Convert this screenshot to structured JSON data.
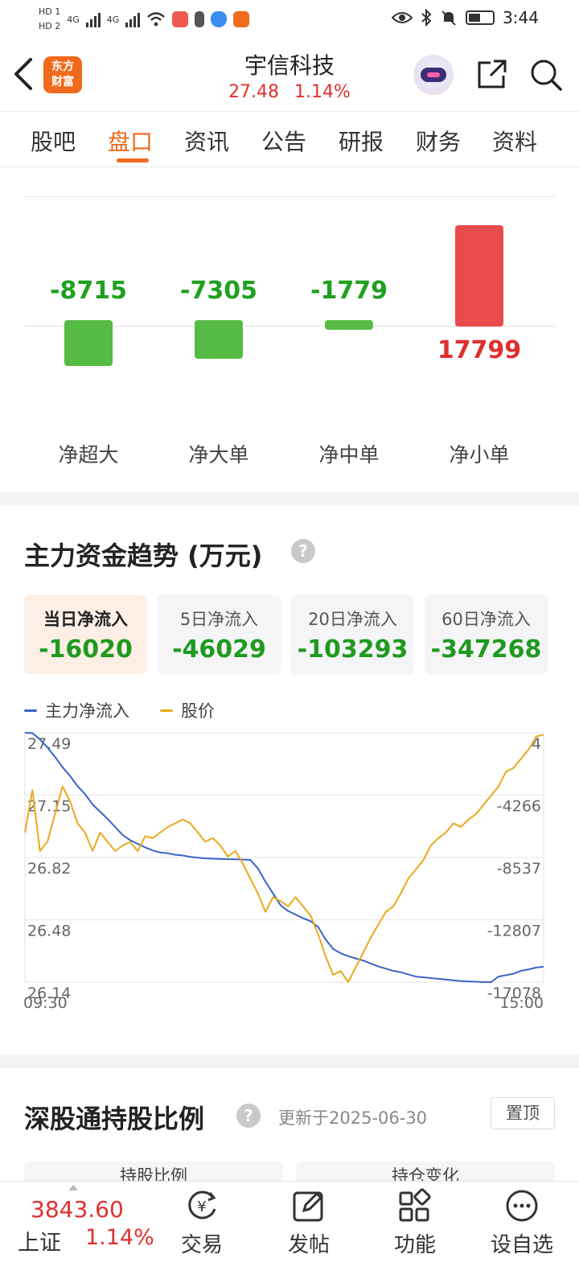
{
  "status_bar": {
    "time": "3:44",
    "sim1": "HD 1",
    "sim2": "HD 2",
    "net1": "4G",
    "net2": "4G"
  },
  "header": {
    "logo_line1": "东方",
    "logo_line2": "财富",
    "stock_name": "宇信科技",
    "price": "27.48",
    "change_pct": "1.14%"
  },
  "tabs": [
    "股吧",
    "盘口",
    "资讯",
    "公告",
    "研报",
    "财务",
    "资料"
  ],
  "active_tab": "盘口",
  "net_flow": {
    "items": [
      {
        "label": "净超大",
        "value": "-8715"
      },
      {
        "label": "净大单",
        "value": "-7305"
      },
      {
        "label": "净中单",
        "value": "-1779"
      },
      {
        "label": "净小单",
        "value": "17799"
      }
    ]
  },
  "trend": {
    "title": "主力资金趋势 (万元)",
    "periods": [
      {
        "label": "当日净流入",
        "value": "-16020"
      },
      {
        "label": "5日净流入",
        "value": "-46029"
      },
      {
        "label": "20日净流入",
        "value": "-103293"
      },
      {
        "label": "60日净流入",
        "value": "-347268"
      }
    ],
    "legend_main": "主力净流入",
    "legend_price": "股价"
  },
  "chart_data": {
    "type": "line",
    "x_start": "09:30",
    "x_end": "15:00",
    "left_axis_ticks": [
      "27.49",
      "27.15",
      "26.82",
      "26.48",
      "26.14"
    ],
    "right_axis_ticks": [
      "4",
      "-4266",
      "-8537",
      "-12807",
      "-17078"
    ],
    "series": [
      {
        "name": "主力净流入",
        "color": "#3a63c8",
        "axis": "right",
        "values": [
          4,
          -20,
          -450,
          -1000,
          -1650,
          -2350,
          -2950,
          -3650,
          -4200,
          -4900,
          -5400,
          -5900,
          -6450,
          -7000,
          -7350,
          -7600,
          -7850,
          -8050,
          -8200,
          -8250,
          -8350,
          -8400,
          -8500,
          -8550,
          -8600,
          -8620,
          -8640,
          -8650,
          -8660,
          -8680,
          -8700,
          -9300,
          -10200,
          -11000,
          -11800,
          -12200,
          -12450,
          -12700,
          -12900,
          -13300,
          -14150,
          -14800,
          -15100,
          -15300,
          -15450,
          -15600,
          -15800,
          -16000,
          -16150,
          -16300,
          -16400,
          -16550,
          -16700,
          -16750,
          -16800,
          -16850,
          -16900,
          -16950,
          -17000,
          -17030,
          -17050,
          -17070,
          -17078,
          -16700,
          -16600,
          -16500,
          -16300,
          -16200,
          -16080,
          -16020
        ]
      },
      {
        "name": "股价",
        "color": "#eaa91c",
        "axis": "left",
        "values": [
          26.95,
          27.18,
          26.85,
          26.9,
          27.05,
          27.2,
          27.12,
          27.0,
          26.95,
          26.85,
          26.95,
          26.9,
          26.85,
          26.88,
          26.9,
          26.85,
          26.93,
          26.92,
          26.95,
          26.98,
          27.0,
          27.02,
          27.0,
          26.95,
          26.9,
          26.92,
          26.88,
          26.82,
          26.85,
          26.78,
          26.7,
          26.62,
          26.52,
          26.6,
          26.58,
          26.55,
          26.6,
          26.55,
          26.5,
          26.4,
          26.28,
          26.18,
          26.2,
          26.12,
          26.22,
          26.3,
          26.38,
          26.45,
          26.52,
          26.55,
          26.62,
          26.7,
          26.75,
          26.8,
          26.88,
          26.92,
          26.95,
          27.0,
          26.98,
          27.02,
          27.05,
          27.1,
          27.15,
          27.2,
          27.28,
          27.3,
          27.35,
          27.4,
          27.47,
          27.48
        ]
      }
    ],
    "ylim_left": [
      26.14,
      27.49
    ],
    "ylim_right": [
      -17078,
      4
    ],
    "grid": true
  },
  "hk_connect": {
    "title": "深股通持股比例",
    "updated": "更新于2025-06-30",
    "pin_label": "置顶",
    "sub_tabs": [
      "持股比例",
      "持仓变化"
    ]
  },
  "bottom_nav": {
    "index_value": "3843.60",
    "index_name": "上证",
    "index_pct": "1.14%",
    "items": [
      "交易",
      "发帖",
      "功能",
      "设自选"
    ]
  }
}
